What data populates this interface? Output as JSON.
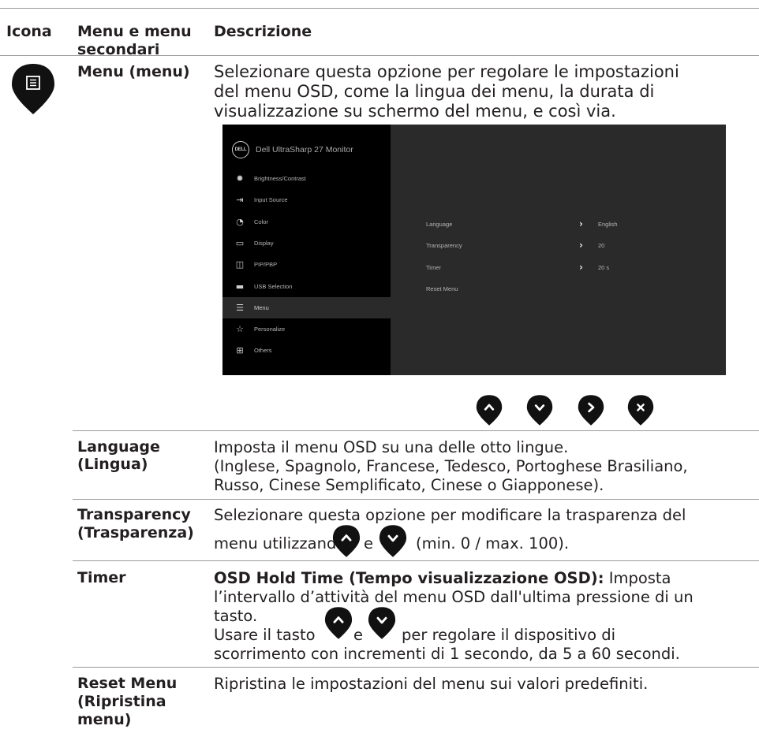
{
  "header": {
    "col_icon": "Icona",
    "col_menu": "Menu e menu secondari",
    "col_desc": "Descrizione"
  },
  "menu_row": {
    "label": "Menu (menu)",
    "desc": [
      "Selezionare questa opzione per regolare le impostazioni",
      "del menu OSD, come la lingua dei menu, la durata di",
      "visualizzazione su schermo del menu, e così via."
    ]
  },
  "osd": {
    "logo": "DELL",
    "title": "Dell UltraSharp 27 Monitor",
    "items": [
      {
        "label": "Brightness/Contrast",
        "icon": "brightness-icon",
        "glyph": "✹"
      },
      {
        "label": "Input Source",
        "icon": "input-source-icon",
        "glyph": "⇥"
      },
      {
        "label": "Color",
        "icon": "color-icon",
        "glyph": "◔"
      },
      {
        "label": "Display",
        "icon": "display-icon",
        "glyph": "▭"
      },
      {
        "label": "PIP/PBP",
        "icon": "pip-pbp-icon",
        "glyph": "◫"
      },
      {
        "label": "USB Selection",
        "icon": "usb-icon",
        "glyph": "▬"
      },
      {
        "label": "Menu",
        "icon": "menu-icon",
        "glyph": "☰"
      },
      {
        "label": "Personalize",
        "icon": "star-icon",
        "glyph": "☆"
      },
      {
        "label": "Others",
        "icon": "others-icon",
        "glyph": "⊞"
      }
    ],
    "active_index": 6,
    "options": [
      {
        "label": "Language",
        "value": "English"
      },
      {
        "label": "Transparency",
        "value": "20"
      },
      {
        "label": "Timer",
        "value": "20 s"
      },
      {
        "label": "Reset Menu",
        "value": ""
      }
    ]
  },
  "nav_buttons": [
    "up-button-icon",
    "down-button-icon",
    "right-button-icon",
    "close-button-icon"
  ],
  "rows": {
    "language": {
      "label": [
        "Language",
        "(Lingua)"
      ],
      "desc": [
        "Imposta il menu OSD su una delle otto lingue.",
        "(Inglese, Spagnolo, Francese, Tedesco, Portoghese Brasiliano,",
        "Russo, Cinese Semplificato, Cinese o Giapponese)."
      ]
    },
    "transparency": {
      "label": [
        "Transparency",
        "(Trasparenza)"
      ],
      "desc1": "Selezionare questa opzione per modificare la trasparenza del",
      "desc2a": "menu utilizzando",
      "desc2b": "e",
      "desc2c": "(min. 0 / max. 100)."
    },
    "timer": {
      "label": "Timer",
      "bold": "OSD Hold Time (Tempo visualizzazione OSD):",
      "after_bold": " Imposta",
      "line2": "l’intervallo d’attività del menu OSD dall'ultima pressione di un",
      "line3": "tasto.",
      "line4a": "Usare il tasto",
      "line4b": "e",
      "line4c": "per regolare il dispositivo di",
      "line5": "scorrimento con incrementi di 1 secondo, da 5 a 60 secondi."
    },
    "reset": {
      "label": [
        "Reset Menu",
        "(Ripristina",
        "menu)"
      ],
      "desc": "Ripristina le impostazioni del menu sui valori predefiniti."
    }
  },
  "colors": {
    "rule": "#9a9a9a",
    "text": "#231f20",
    "osd_bg": "#2a2a2a",
    "osd_side": "#000000"
  }
}
